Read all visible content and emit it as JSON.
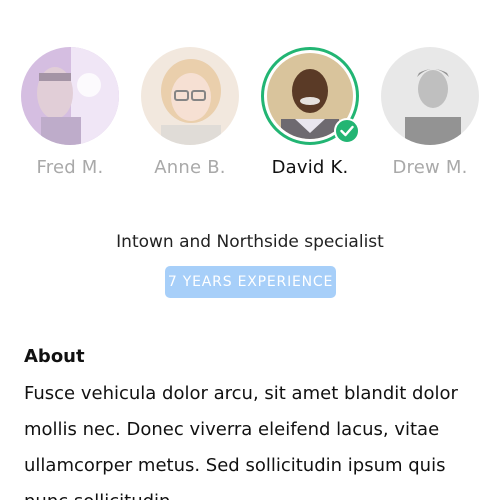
{
  "agents": [
    {
      "name": "Fred M.",
      "selected": false
    },
    {
      "name": "Anne B.",
      "selected": false
    },
    {
      "name": "David K.",
      "selected": true
    },
    {
      "name": "Drew M.",
      "selected": false
    }
  ],
  "profile": {
    "specialty": "Intown and Northside specialist",
    "experience_badge": "7 YEARS EXPERIENCE",
    "about_title": "About",
    "about_text": "Fusce vehicula dolor arcu, sit amet blandit dolor mollis nec. Donec viverra eleifend lacus, vitae ullamcorper metus. Sed sollicitudin ipsum quis nunc sollicitudin"
  },
  "colors": {
    "selected_ring": "#22b573",
    "badge_background": "#a7cff9",
    "inactive_name": "#a9a9a9"
  }
}
